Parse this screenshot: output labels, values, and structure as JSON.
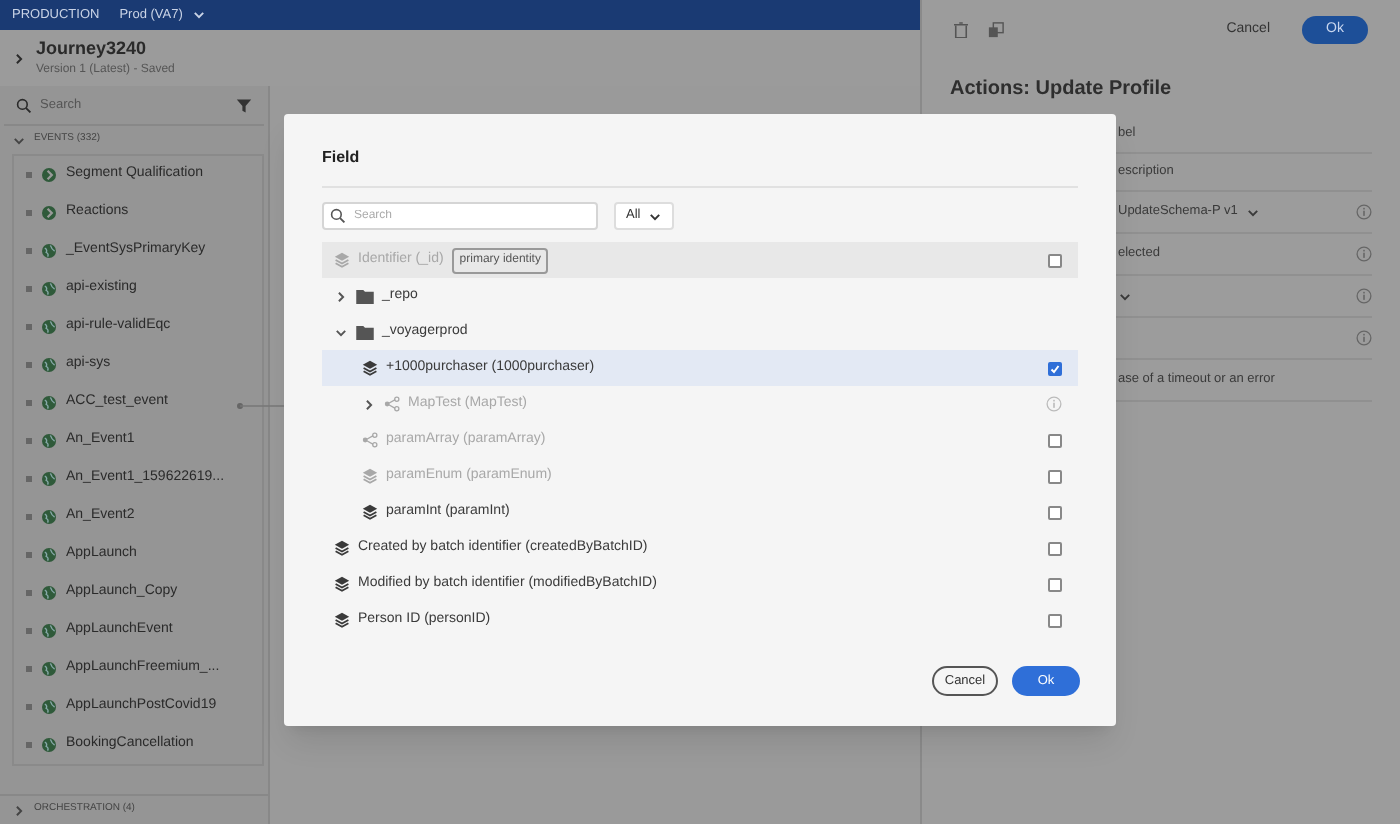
{
  "top_bar": {
    "environment": "PRODUCTION",
    "sandbox": "Prod (VA7)"
  },
  "journey": {
    "title": "Journey3240",
    "subtitle": "Version 1 (Latest) - Saved"
  },
  "sidebar": {
    "search": {
      "placeholder": "Search"
    },
    "sections": [
      {
        "label": "EVENTS (332)",
        "expanded": true,
        "items": [
          {
            "label": "Segment Qualification",
            "kind": "segment"
          },
          {
            "label": "Reactions",
            "kind": "segment"
          },
          {
            "label": "_EventSysPrimaryKey",
            "kind": "globe"
          },
          {
            "label": "api-existing",
            "kind": "globe"
          },
          {
            "label": "api-rule-validEqc",
            "kind": "globe"
          },
          {
            "label": "api-sys",
            "kind": "globe"
          },
          {
            "label": "ACC_test_event",
            "kind": "globe"
          },
          {
            "label": "An_Event1",
            "kind": "globe"
          },
          {
            "label": "An_Event1_159622619...",
            "kind": "globe"
          },
          {
            "label": "An_Event2",
            "kind": "globe"
          },
          {
            "label": "AppLaunch",
            "kind": "globe"
          },
          {
            "label": "AppLaunch_Copy",
            "kind": "globe"
          },
          {
            "label": "AppLaunchEvent",
            "kind": "globe"
          },
          {
            "label": "AppLaunchFreemium_...",
            "kind": "globe"
          },
          {
            "label": "AppLaunchPostCovid19",
            "kind": "globe"
          },
          {
            "label": "BookingCancellation",
            "kind": "globe"
          }
        ]
      },
      {
        "label": "ORCHESTRATION (4)",
        "expanded": false
      }
    ]
  },
  "right_panel": {
    "cancel": "Cancel",
    "ok": "Ok",
    "title": "Actions: Update Profile",
    "rows": [
      {
        "text": "bel",
        "info": false
      },
      {
        "text": "escription",
        "info": false
      },
      {
        "text": "UpdateSchema-P v1",
        "dropdown": true,
        "info": true
      },
      {
        "text": "elected",
        "info": true
      },
      {
        "dropdown": true,
        "info": true
      },
      {
        "info": true
      },
      {
        "text": "ase of a timeout or an error",
        "info": false
      }
    ]
  },
  "dialog": {
    "title": "Field",
    "search": {
      "placeholder": "Search"
    },
    "filter": "All",
    "tree": [
      {
        "label": "Identifier (_id)",
        "badge": "primary identity",
        "kind": "field",
        "disabled": true,
        "hovered": true,
        "selected": false,
        "checked": false
      },
      {
        "label": "_repo",
        "kind": "folder",
        "expanded": false
      },
      {
        "label": "_voyagerprod",
        "kind": "folder",
        "expanded": true,
        "children": [
          {
            "label": "+1000purchaser (1000purchaser)",
            "kind": "field",
            "disabled": false,
            "hovered": false,
            "selected": true,
            "checked": true
          },
          {
            "label": "MapTest (MapTest)",
            "kind": "map",
            "disabled": true,
            "expanded": false
          },
          {
            "label": "paramArray (paramArray)",
            "kind": "array",
            "disabled": true,
            "hovered": false,
            "selected": false,
            "checked": false
          },
          {
            "label": "paramEnum (paramEnum)",
            "kind": "field",
            "disabled": true,
            "hovered": false,
            "selected": false,
            "checked": false
          },
          {
            "label": "paramInt (paramInt)",
            "kind": "field",
            "disabled": false,
            "hovered": false,
            "selected": false,
            "checked": false
          }
        ]
      },
      {
        "label": "Created by batch identifier (createdByBatchID)",
        "kind": "field",
        "disabled": false,
        "hovered": false,
        "selected": false,
        "checked": false
      },
      {
        "label": "Modified by batch identifier (modifiedByBatchID)",
        "kind": "field",
        "disabled": false,
        "hovered": false,
        "selected": false,
        "checked": false
      },
      {
        "label": "Person ID (personID)",
        "kind": "field",
        "disabled": false,
        "hovered": false,
        "selected": false,
        "checked": false
      }
    ],
    "cancel": "Cancel",
    "ok": "Ok"
  }
}
